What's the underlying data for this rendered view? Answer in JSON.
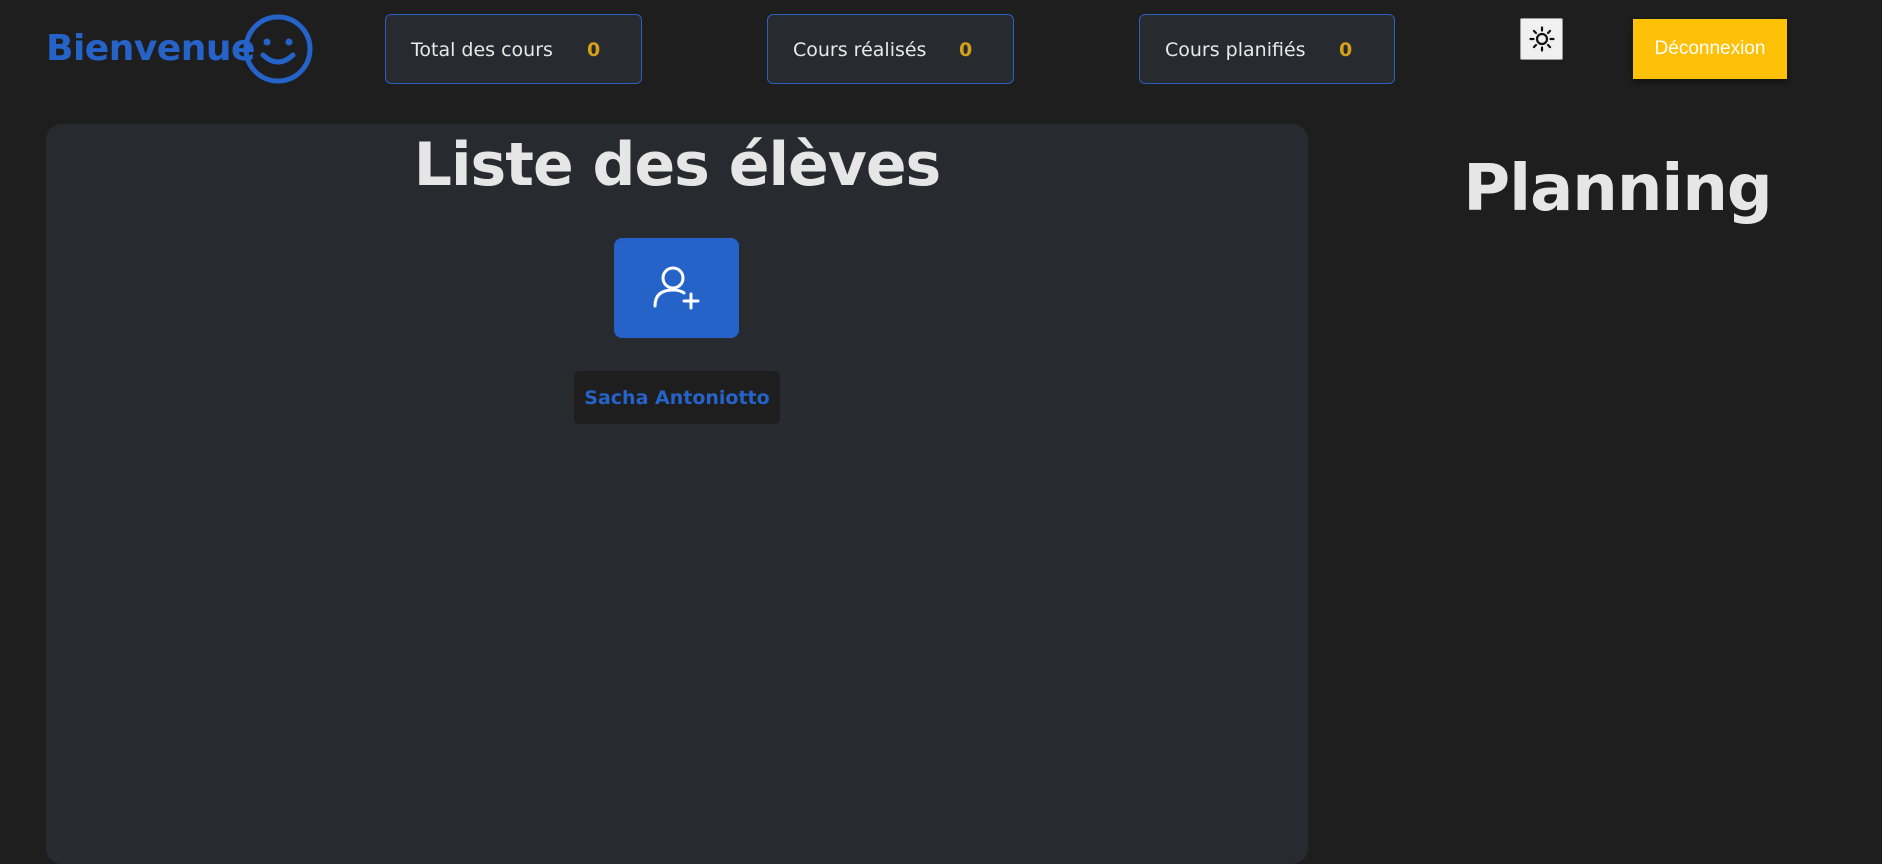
{
  "header": {
    "welcome": "Bienvenue",
    "stats": [
      {
        "label": "Total des cours",
        "value": "0"
      },
      {
        "label": "Cours réalisés",
        "value": "0"
      },
      {
        "label": "Cours planifiés",
        "value": "0"
      }
    ],
    "logout_label": "Déconnexion"
  },
  "students": {
    "title": "Liste des élèves",
    "items": [
      "Sacha Antoniotto"
    ]
  },
  "planning": {
    "title": "Planning"
  },
  "colors": {
    "accent": "#2563c9",
    "stat_value": "#d4a017",
    "logout": "#ffc107",
    "background": "#1e1e1e",
    "panel": "#272b30"
  },
  "icons": {
    "welcome": "smiley-icon",
    "theme_toggle": "sun-icon",
    "add_student": "add-user-icon"
  }
}
